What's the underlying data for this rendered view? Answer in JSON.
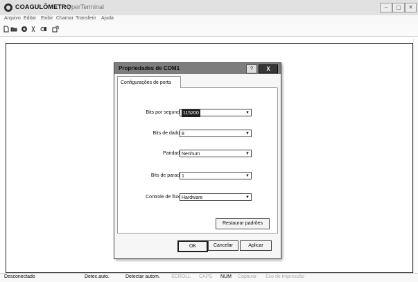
{
  "app": {
    "title": "COAGULÔMETRO",
    "subtitle": "HyperTerminal",
    "window_buttons": {
      "minimize": "–",
      "maximize": "▢",
      "close": "✕"
    }
  },
  "menu": [
    "Arquivo",
    "Editar",
    "Exibir",
    "Chamar",
    "Transferir",
    "Ajuda"
  ],
  "toolbar": {
    "icons": [
      "new-document-icon",
      "open-folder-icon",
      "phone-icon",
      "disconnect-icon",
      "send-receive-icon",
      "properties-icon"
    ]
  },
  "dialog": {
    "title": "Propriedades de COM1",
    "help_label": "?",
    "close_label": "X",
    "tab_label": "Configurações de porta",
    "fields": [
      {
        "label": "Bits por segundo:",
        "value": "115200",
        "highlighted": true
      },
      {
        "label": "Bits de dados:",
        "value": "8",
        "highlighted": false
      },
      {
        "label": "Paridade:",
        "value": "Nenhum",
        "highlighted": false
      },
      {
        "label": "Bits de parada:",
        "value": "1",
        "highlighted": false
      },
      {
        "label": "Controle de fluxo:",
        "value": "Hardware",
        "highlighted": false
      }
    ],
    "restore_label": "Restaurar padrões",
    "ok_label": "OK",
    "cancel_label": "Cancelar",
    "apply_label": "Aplicar"
  },
  "status": {
    "connection": "Desconectado",
    "detect1": "Detec.auto.",
    "detect2": "Detectar autom.",
    "scroll": "SCROLL",
    "caps": "CAPS",
    "num": "NUM",
    "capture": "Capturar",
    "print_echo": "Eco de impressão"
  }
}
